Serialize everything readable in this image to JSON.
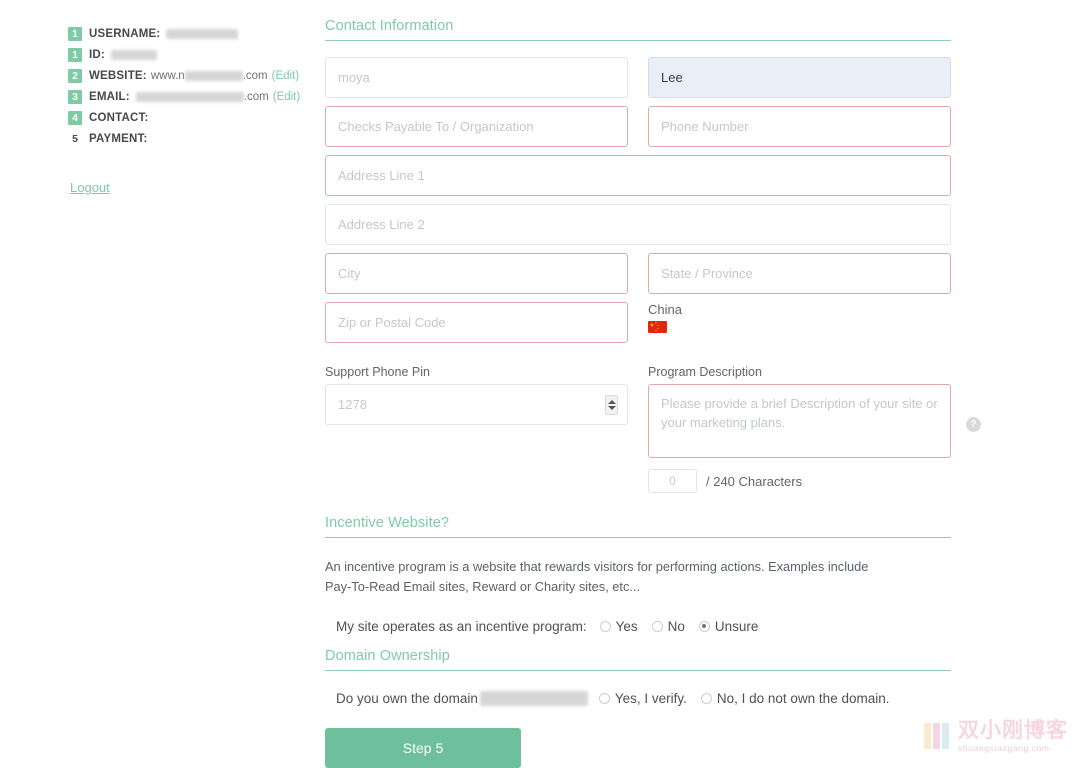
{
  "sidebar": {
    "account_rows": [
      {
        "step": "1",
        "label": "USERNAME:",
        "value": "",
        "redacted": true,
        "redact_width": 72,
        "edit": null
      },
      {
        "step": "1",
        "label": "ID:",
        "value": "",
        "redacted": true,
        "redact_width": 46,
        "edit": null
      },
      {
        "step": "2",
        "label": "WEBSITE:",
        "value": "www.n",
        "value_suffix": ".com",
        "redacted": true,
        "redact_width": 58,
        "edit": "(Edit)"
      },
      {
        "step": "3",
        "label": "EMAIL:",
        "value": "",
        "value_suffix": ".com",
        "redacted": true,
        "redact_width": 108,
        "edit": "(Edit)"
      },
      {
        "step": "4",
        "label": "CONTACT:",
        "value": "",
        "redacted": false,
        "edit": null
      },
      {
        "step": "5",
        "label": "PAYMENT:",
        "value": "",
        "redacted": false,
        "badge_plain": true,
        "edit": null
      }
    ],
    "logout_label": "Logout"
  },
  "contact_section": {
    "heading": "Contact Information",
    "first_name_placeholder": "moya",
    "last_name_value": "Lee",
    "checks_payable_placeholder": "Checks Payable To / Organization",
    "phone_placeholder": "Phone Number",
    "address1_placeholder": "Address Line 1",
    "address2_placeholder": "Address Line 2",
    "city_placeholder": "City",
    "state_placeholder": "State / Province",
    "zip_placeholder": "Zip or Postal Code",
    "country_name": "China",
    "country_flag": "cn-flag-icon"
  },
  "support": {
    "pin_label": "Support Phone Pin",
    "pin_placeholder": "1278",
    "description_label": "Program Description",
    "description_placeholder": "Please provide a brief Description of your site or your marketing plans.",
    "help_icon": "help-circle-icon",
    "help_glyph": "?",
    "char_count": "0",
    "char_limit_text": "/ 240 Characters"
  },
  "incentive": {
    "heading": "Incentive Website?",
    "description": "An incentive program is a website that rewards visitors for performing actions. Examples include Pay-To-Read Email sites, Reward or Charity sites, etc...",
    "question": "My site operates as an incentive program:",
    "options": [
      {
        "label": "Yes",
        "selected": false
      },
      {
        "label": "No",
        "selected": false
      },
      {
        "label": "Unsure",
        "selected": true
      }
    ]
  },
  "domain_ownership": {
    "heading": "Domain Ownership",
    "question_prefix": "Do you own the domain",
    "domain_redacted": true,
    "options": [
      {
        "label": "Yes, I verify.",
        "selected": false
      },
      {
        "label": "No, I do not own the domain.",
        "selected": false
      }
    ]
  },
  "submit": {
    "label": "Step 5"
  },
  "watermark": {
    "title": "双小刚博客",
    "url": "shuangxiaogang.com"
  },
  "colors": {
    "accent_green": "#7ecba6",
    "button_green": "#6ec09c",
    "required_border": "#e5a8a8",
    "optional_border": "#e3e5e7",
    "filled_bg": "#e9eff9"
  }
}
